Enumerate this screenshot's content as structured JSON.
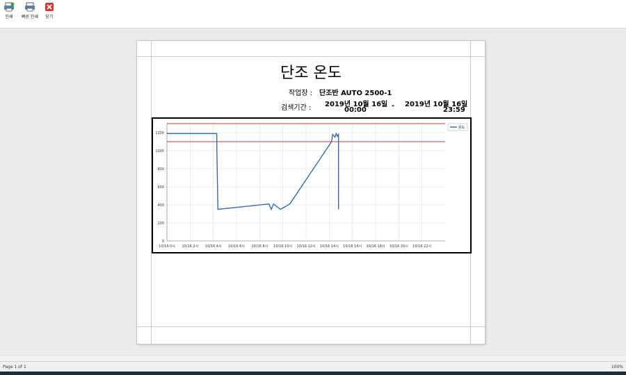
{
  "toolbar": {
    "print_label": "인쇄",
    "quick_print_label": "빠른 인쇄",
    "close_label": "닫기"
  },
  "report": {
    "title": "단조 온도",
    "workplace_label": "작업장 :",
    "workplace_value": "단조반 AUTO 2500-1",
    "period_label": "검색기간 :",
    "start_date": "2019년 10월 16일",
    "start_time": "00:00",
    "separator": "-",
    "end_date": "2019년 10월 16일",
    "end_time": "23:59"
  },
  "chart_data": {
    "type": "line",
    "legend": "온도",
    "legend_position": "top-right",
    "grid": true,
    "ylim": [
      0,
      1300
    ],
    "yticks": [
      0,
      200,
      400,
      600,
      800,
      1000,
      1200
    ],
    "xticks": [
      "10/16 0시",
      "10/16 2시",
      "10/16 4시",
      "10/16 6시",
      "10/16 8시",
      "10/16 10시",
      "10/16 12시",
      "10/16 14시",
      "10/16 16시",
      "10/16 18시",
      "10/16 20시",
      "10/16 22시"
    ],
    "x_unit": "hour",
    "xlim": [
      0,
      24
    ],
    "upper_limit": 1300,
    "lower_limit": 1100,
    "limit_color": "#e03030",
    "series_color": "#2e6db4",
    "series": [
      {
        "name": "온도",
        "x": [
          0,
          2.0,
          4.3,
          4.3,
          4.4,
          8.8,
          9.0,
          9.2,
          9.8,
          10.6,
          14.2,
          14.3,
          14.5,
          14.6,
          14.7,
          14.8,
          14.8
        ],
        "y": [
          1190,
          1190,
          1190,
          1050,
          350,
          410,
          350,
          410,
          350,
          410,
          1100,
          1180,
          1150,
          1190,
          1160,
          1180,
          350
        ]
      }
    ]
  },
  "status": {
    "page_info": "Page 1 of 1",
    "zoom": "100%"
  }
}
